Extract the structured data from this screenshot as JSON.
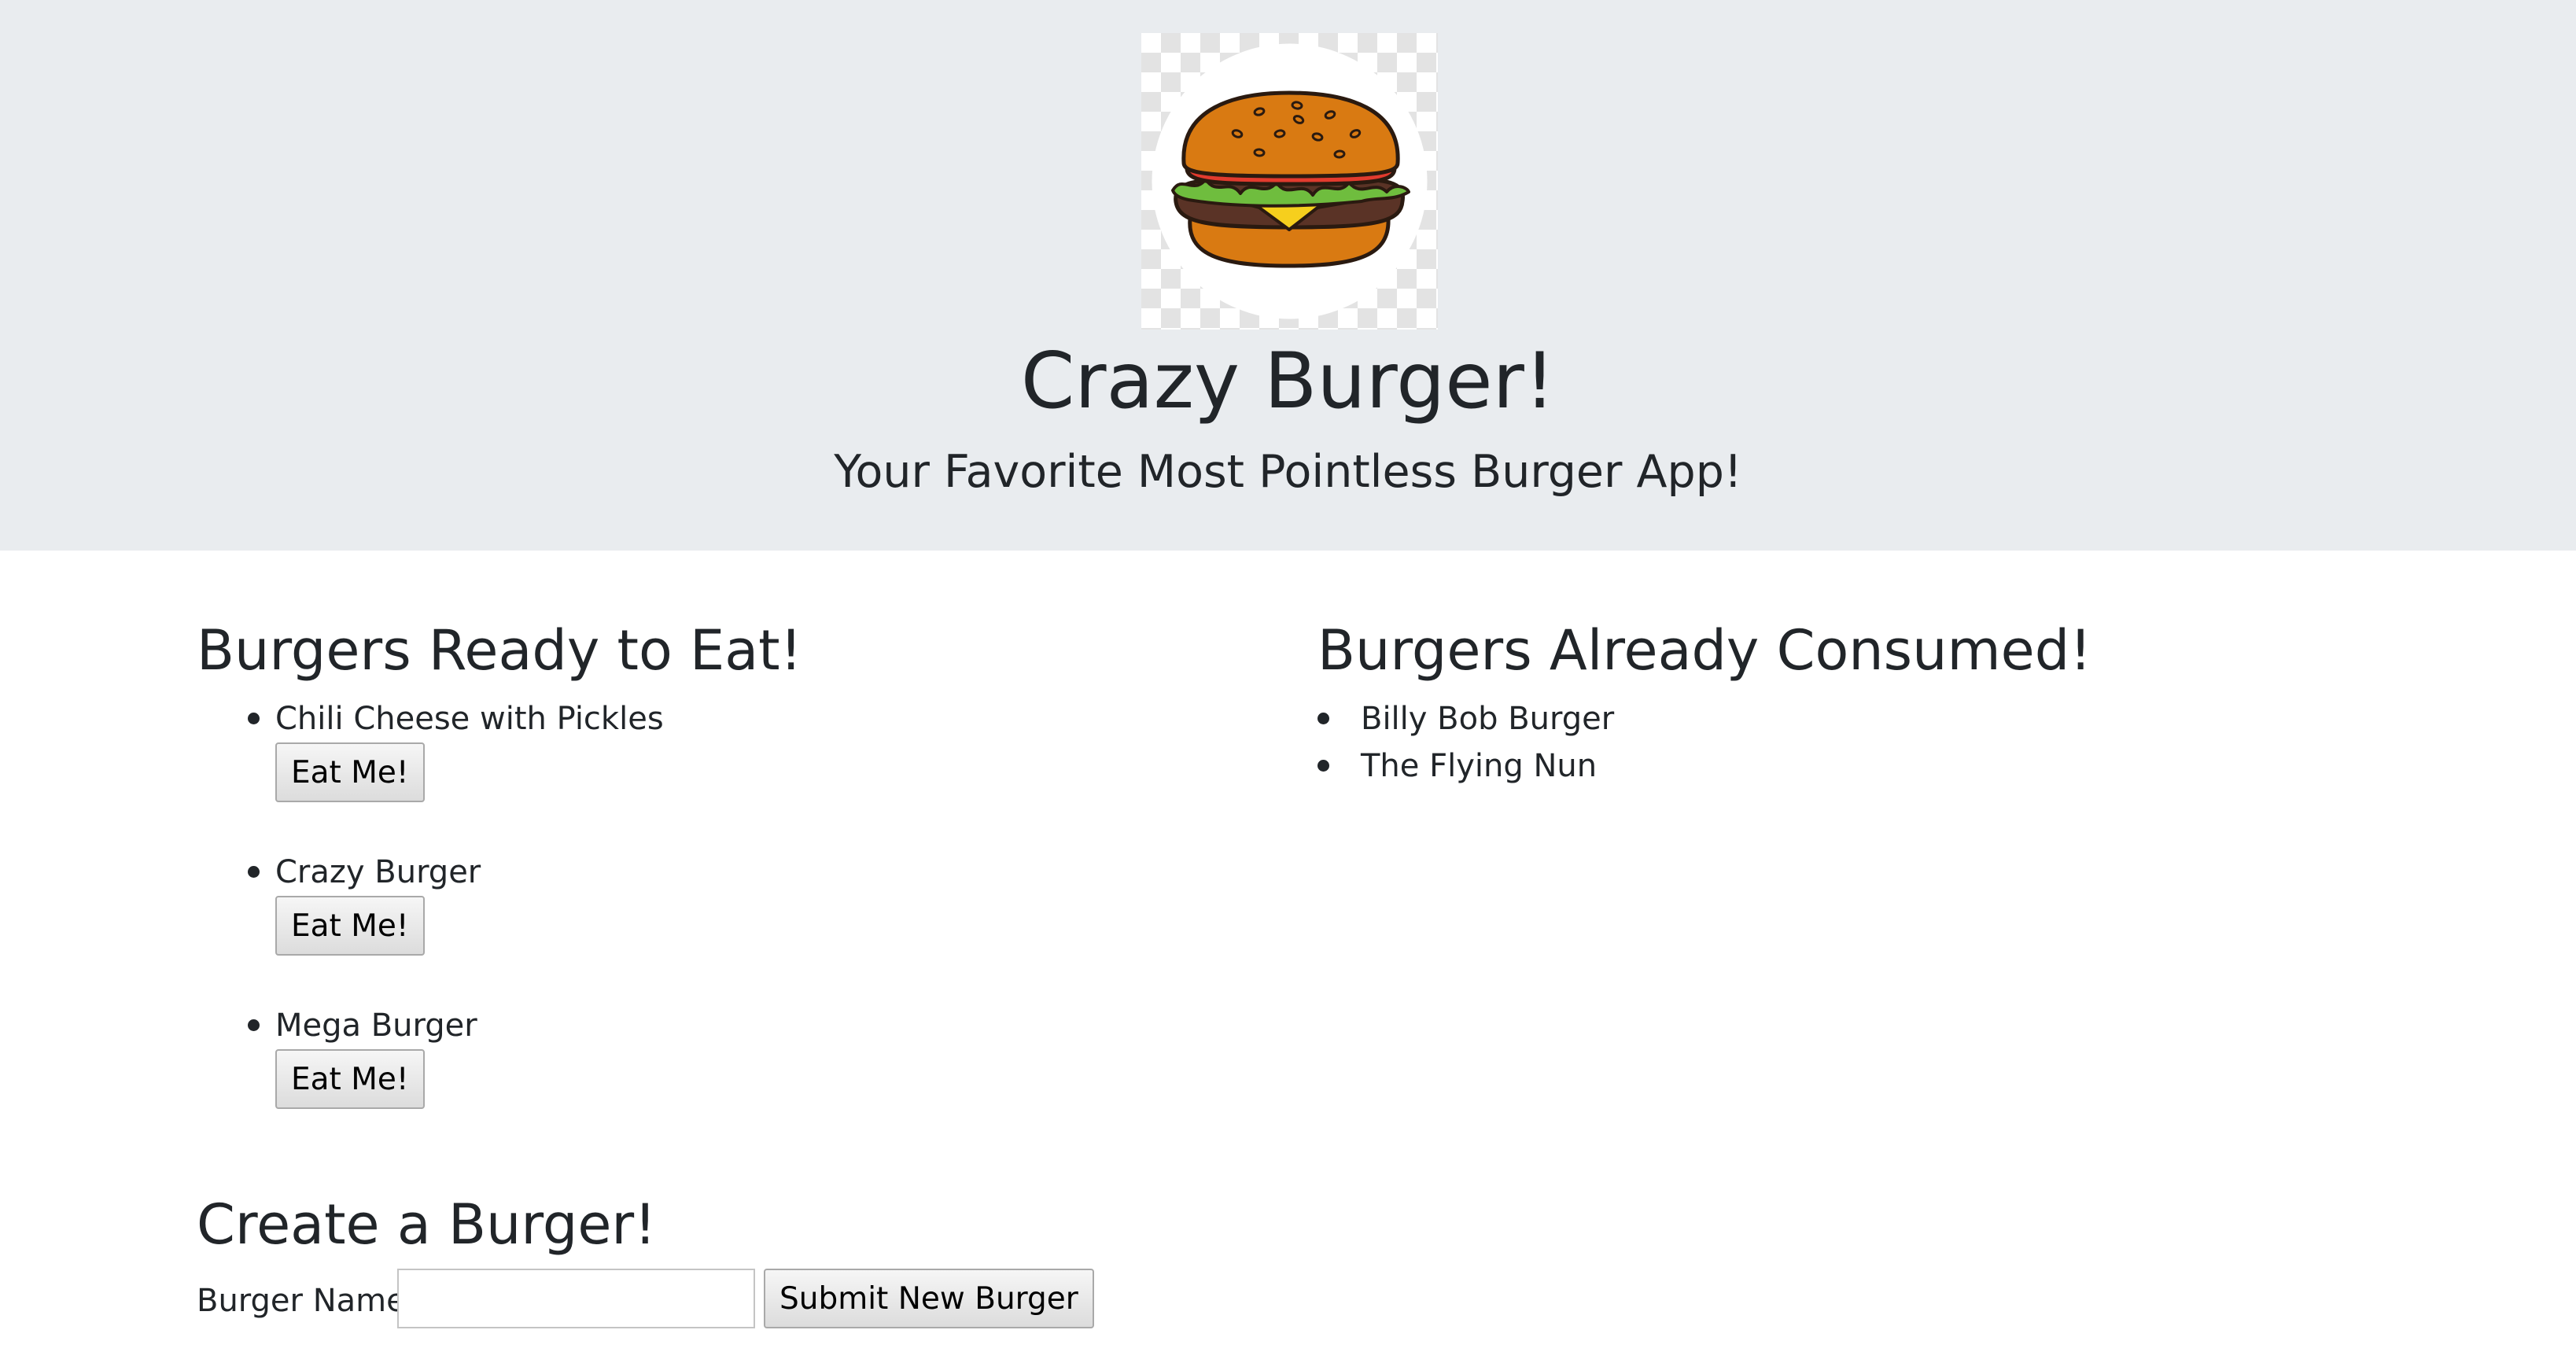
{
  "header": {
    "title": "Crazy Burger!",
    "subtitle": "Your Favorite Most Pointless Burger App!",
    "logo_icon": "burger-logo-icon"
  },
  "ready": {
    "heading": "Burgers Ready to Eat!",
    "items": [
      {
        "name": "Chili Cheese with Pickles",
        "button": "Eat Me!"
      },
      {
        "name": "Crazy Burger",
        "button": "Eat Me!"
      },
      {
        "name": "Mega Burger",
        "button": "Eat Me!"
      }
    ]
  },
  "consumed": {
    "heading": "Burgers Already Consumed!",
    "items": [
      {
        "name": "Billy Bob Burger"
      },
      {
        "name": "The Flying Nun"
      }
    ]
  },
  "create": {
    "heading": "Create a Burger!",
    "label": "Burger Name:",
    "input_value": "",
    "submit": "Submit New Burger"
  },
  "colors": {
    "header_bg": "#e9ecef",
    "text": "#212529",
    "bun": "#d97a12",
    "patty": "#5a3326",
    "cheese": "#f6cf1d",
    "lettuce": "#6fbd3e",
    "tomato": "#e23b2e"
  }
}
